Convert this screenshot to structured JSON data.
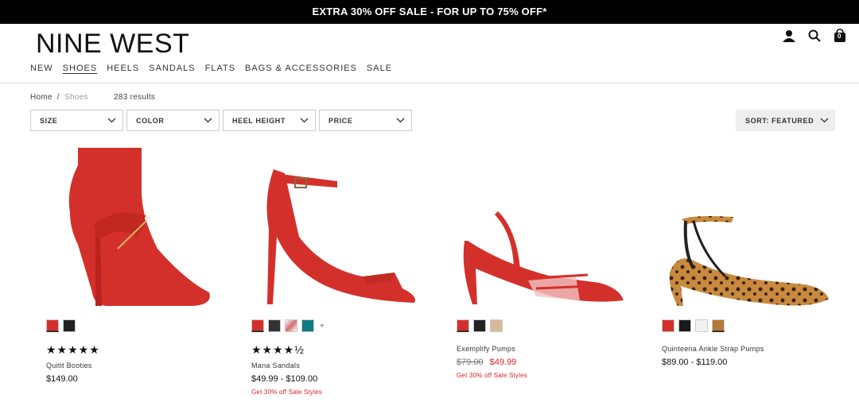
{
  "promo": "EXTRA 30% OFF SALE - FOR UP TO 75% OFF*",
  "logo": "NINE WEST",
  "nav": [
    "NEW",
    "SHOES",
    "HEELS",
    "SANDALS",
    "FLATS",
    "BAGS & ACCESSORIES",
    "SALE"
  ],
  "active_nav": "SHOES",
  "breadcrumb": {
    "home": "Home",
    "separator": "/",
    "current": "Shoes"
  },
  "results": "283 results",
  "filters": [
    "SIZE",
    "COLOR",
    "HEEL HEIGHT",
    "PRICE"
  ],
  "sort": "SORT: FEATURED",
  "icons": [
    "account-icon",
    "search-icon",
    "cart-icon"
  ],
  "cart_count": "0",
  "products": [
    {
      "name": "Quitit Booties",
      "price": "$149.00",
      "stars": "★★★★★",
      "swatch_colors": [
        "#d4302b",
        "#222222"
      ]
    },
    {
      "name": "Mana Sandals",
      "price": "$49.99 - $109.00",
      "stars": "★★★★½",
      "swatch_colors": [
        "#d4302b",
        "#333333",
        "#d07070",
        "#0f7b83"
      ],
      "more": "+",
      "promo_note": "Get 30% off Sale Styles"
    },
    {
      "name": "Exemplify Pumps",
      "original_price": "$79.00",
      "sale_price": "$49.99",
      "swatch_colors": [
        "#d4302b",
        "#222222",
        "#d9b99b"
      ],
      "promo_note": "Get 30% off Sale Styles"
    },
    {
      "name": "Quinteena Ankle Strap Pumps",
      "price": "$89.00 - $119.00",
      "swatch_colors": [
        "#d4302b",
        "#1a1a1a",
        "#f2f2f2",
        "#b37a3a"
      ]
    }
  ]
}
